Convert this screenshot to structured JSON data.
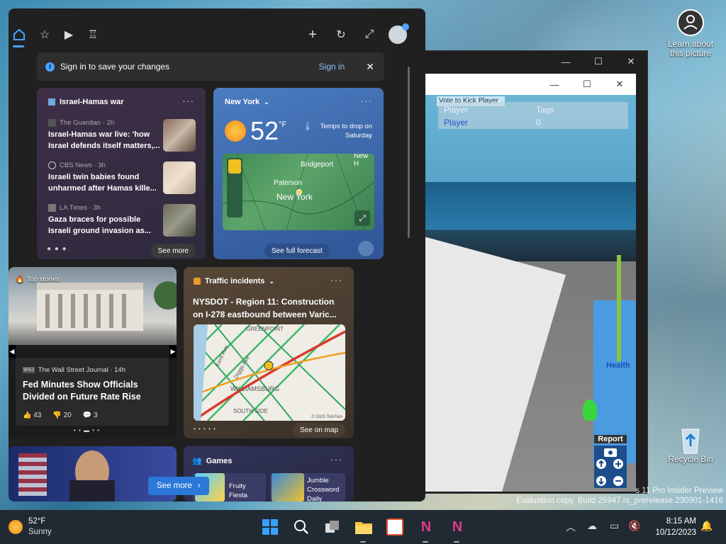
{
  "desktop": {
    "learn_icon_label": "Learn about this picture",
    "recycle_bin_label": "Recycle Bin",
    "watermark_line1": "s 11 Pro Insider Preview",
    "watermark_line2": "Evaluation copy. Build 25947.rs_prerelease.230901-1416"
  },
  "game": {
    "vote_label": "Vote to Kick Player",
    "col_player": "Player",
    "col_tags": "Tags",
    "row_player": "Player",
    "row_tags": "0",
    "health_label": "Health",
    "health_level": 0.7,
    "report_label": "Report"
  },
  "widgets": {
    "sign_in_message": "Sign in to save your changes",
    "sign_in_button": "Sign in",
    "news_card": {
      "title": "Israel-Hamas war",
      "items": [
        {
          "source": "The Guardian · 2h",
          "headline1": "Israel-Hamas war live: 'how",
          "headline2": "Israel defends itself matters,..."
        },
        {
          "source": "CBS News · 3h",
          "headline1": "Israeli twin babies found",
          "headline2": "unharmed after Hamas kille..."
        },
        {
          "source": "LA Times · 3h",
          "headline1": "Gaza braces for possible",
          "headline2": "Israeli ground invasion as..."
        }
      ],
      "see_more": "See more"
    },
    "weather_card": {
      "location": "New York",
      "temp": "52",
      "unit": "°F",
      "note": "Temps to drop on Saturday",
      "map_labels": [
        "Bridgeport",
        "Paterson",
        "New York",
        "New H"
      ],
      "see_forecast": "See full forecast"
    },
    "top_stories": {
      "label": "Top stories",
      "source": "The Wall Street Journal · 14h",
      "headline1": "Fed Minutes Show Officials",
      "headline2": "Divided on Future Rate Rise",
      "likes": "43",
      "dislikes": "20",
      "comments": "3"
    },
    "traffic_card": {
      "title": "Traffic incidents",
      "headline1": "NYSDOT - Region 11: Construction",
      "headline2": "on I-278 eastbound between Varic...",
      "map_labels": [
        "GREENPOINT",
        "Kent Ave",
        "Diggs Ave",
        "WILLIAMSBURG",
        "SOUTH SIDE"
      ],
      "copyright": "© 2023 TomTom",
      "see_on_map": "See on map"
    },
    "games_card": {
      "title": "Games",
      "game1": "Fruity Fiesta",
      "game2": "Jumble Crossword Daily"
    },
    "see_more_button": "See more"
  },
  "taskbar": {
    "weather_temp": "52°F",
    "weather_desc": "Sunny",
    "time": "8:15 AM",
    "date": "10/12/2023"
  },
  "colors": {
    "panel_bg": "#202020",
    "accent": "#4aa3ff",
    "news_card": "#3a2a3e",
    "weather_card": "#3a64a6",
    "traffic_card": "#4a3e32",
    "games_card": "#2d2e4d"
  }
}
